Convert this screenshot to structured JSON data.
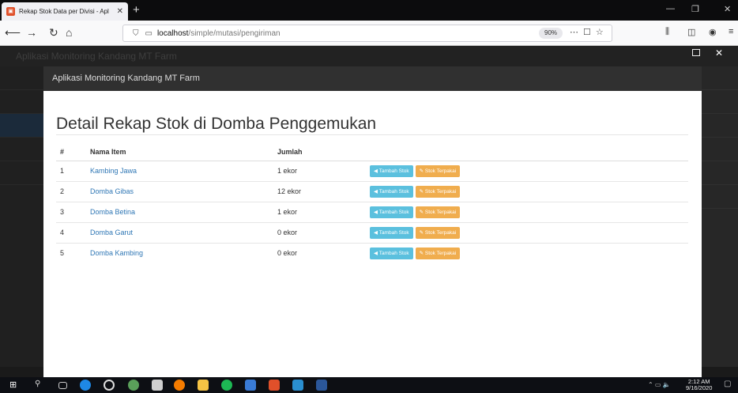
{
  "browser": {
    "tab_title": "Rekap Stok Data per Divisi - Apl",
    "url_host": "localhost",
    "url_path": "/simple/mutasi/pengiriman",
    "zoom": "90%"
  },
  "app": {
    "bg_title": "Aplikasi Monitoring Kandang MT Farm"
  },
  "modal": {
    "title": "Aplikasi Monitoring Kandang MT Farm",
    "heading": "Detail Rekap Stok di Domba Penggemukan",
    "columns": {
      "num": "#",
      "name": "Nama Item",
      "qty": "Jumlah"
    },
    "btn_add": "Tambah Stok",
    "btn_used": "Stok Terpakai",
    "rows": [
      {
        "num": "1",
        "name": "Kambing Jawa",
        "qty": "1 ekor"
      },
      {
        "num": "2",
        "name": "Domba Gibas",
        "qty": "12 ekor"
      },
      {
        "num": "3",
        "name": "Domba Betina",
        "qty": "1 ekor"
      },
      {
        "num": "4",
        "name": "Domba Garut",
        "qty": "0 ekor"
      },
      {
        "num": "5",
        "name": "Domba Kambing",
        "qty": "0 ekor"
      }
    ]
  },
  "taskbar": {
    "time": "2:12 AM",
    "date": "9/16/2020"
  },
  "colors": {
    "info": "#5bc0de",
    "warning": "#f0ad4e",
    "link": "#2f77b5"
  }
}
